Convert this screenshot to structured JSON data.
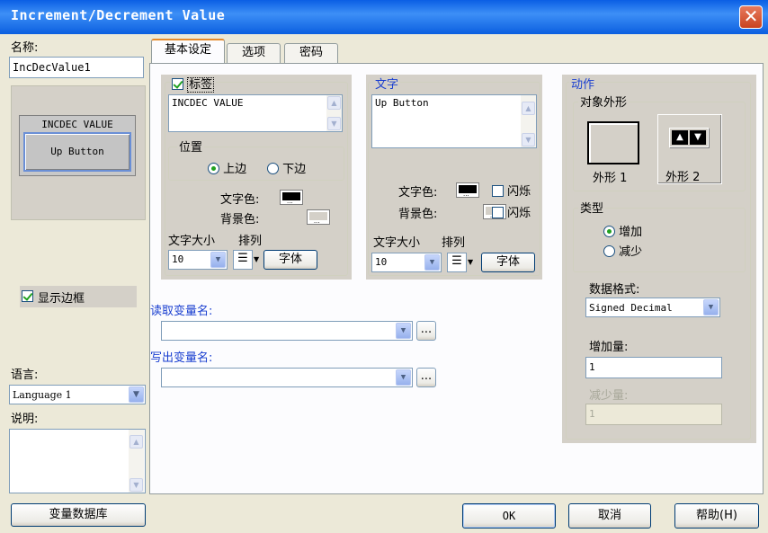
{
  "window": {
    "title": "Increment/Decrement Value",
    "close_icon": "close-icon"
  },
  "left": {
    "name_label": "名称:",
    "name_value": "IncDecValue1",
    "preview": {
      "label": "INCDEC VALUE",
      "button": "Up Button"
    },
    "show_border_label": "显示边框",
    "show_border_checked": true,
    "language_label": "语言:",
    "language_value": "Language 1",
    "description_label": "说明:",
    "description_value": "",
    "tag_db_button": "变量数据库"
  },
  "tabs": [
    {
      "label": "基本设定",
      "active": true
    },
    {
      "label": "选项",
      "active": false
    },
    {
      "label": "密码",
      "active": false
    }
  ],
  "label_group": {
    "title": "标签",
    "checked": true,
    "text": "INCDEC VALUE",
    "position_title": "位置",
    "pos_top": "上边",
    "pos_bottom": "下边",
    "pos_selected": "top",
    "text_color_label": "文字色:",
    "bg_color_label": "背景色:",
    "text_color": "#000000",
    "bg_color": "#d4d0c8",
    "font_size_label": "文字大小",
    "align_label": "排列",
    "font_size_value": "10",
    "font_button": "字体"
  },
  "text_group": {
    "title": "文字",
    "text": "Up Button",
    "text_color_label": "文字色:",
    "bg_color_label": "背景色:",
    "blink_label": "闪烁",
    "text_color": "#000000",
    "bg_color": "#d4d0c8",
    "font_size_label": "文字大小",
    "align_label": "排列",
    "font_size_value": "10",
    "font_button": "字体"
  },
  "read_var": {
    "label": "读取变量名:",
    "value": "",
    "browse": "..."
  },
  "write_var": {
    "label": "写出变量名:",
    "value": "",
    "browse": "..."
  },
  "action": {
    "title": "动作",
    "appearance_title": "对象外形",
    "shape1_label": "外形 1",
    "shape2_label": "外形 2",
    "type_title": "类型",
    "type_increase": "增加",
    "type_decrease": "减少",
    "type_selected": "increase",
    "data_format_label": "数据格式:",
    "data_format_value": "Signed Decimal",
    "increase_label": "增加量:",
    "increase_value": "1",
    "decrease_label": "减少量:",
    "decrease_value": "1"
  },
  "footer": {
    "ok": "OK",
    "cancel": "取消",
    "help": "帮助(H)"
  },
  "colors": {
    "title_blue": "#0a5ee4",
    "panel": "#d4d0c8",
    "dialog": "#ece9d8",
    "group_blue": "#1a3fd0"
  }
}
